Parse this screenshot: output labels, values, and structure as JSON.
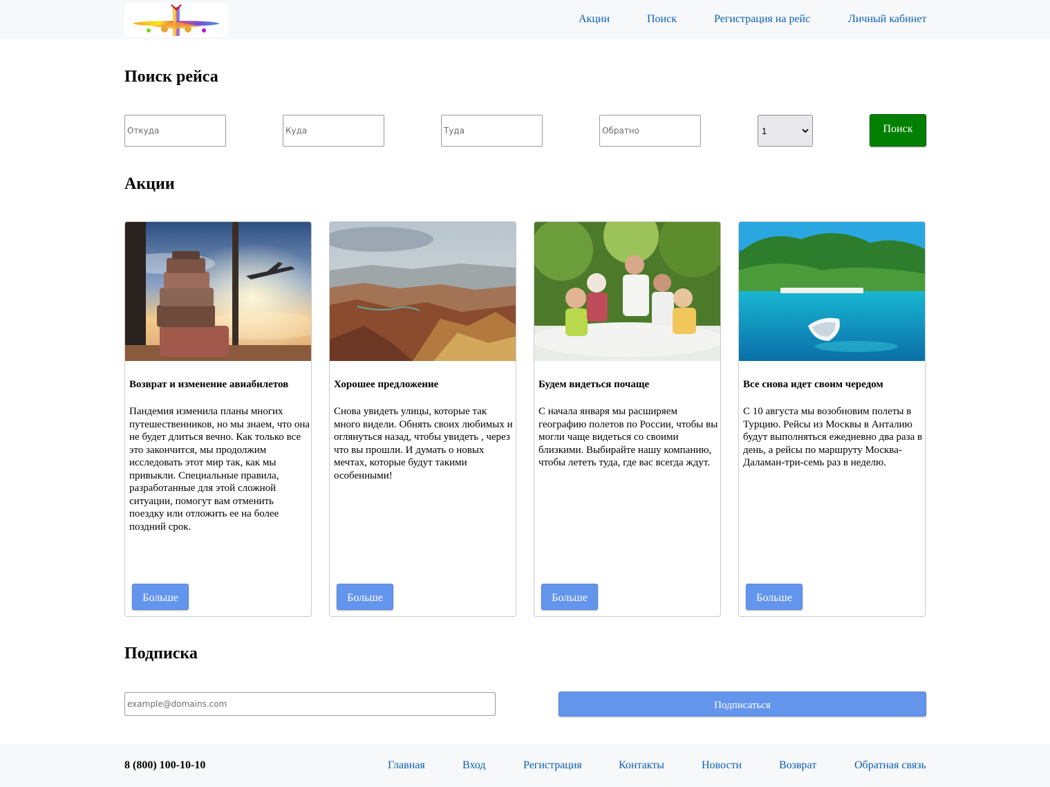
{
  "header": {
    "nav": [
      "Акции",
      "Поиск",
      "Регистрация на рейс",
      "Личный кабинет"
    ]
  },
  "search": {
    "title": "Поиск рейса",
    "from_placeholder": "Откуда",
    "to_placeholder": "Куда",
    "depart_placeholder": "Туда",
    "return_placeholder": "Обратно",
    "passengers_value": "1",
    "button_label": "Поиск",
    "button_color": "#008000"
  },
  "promos": {
    "title": "Акции",
    "more_label": "Больше",
    "accent_color": "#6495ed",
    "cards": [
      {
        "title": "Возврат и изменение авиабилетов",
        "text": "Пандемия изменила планы многих путешественников, но мы знаем, что она не будет длиться вечно. Как только все это закончится, мы продолжим исследовать этот мир так, как мы привыкли. Специальные правила, разработанные для этой сложной ситуации, помогут вам отменить поездку или отложить ее на более поздний срок.",
        "image": "suitcases-airplane-sunset"
      },
      {
        "title": "Хорошее предложение",
        "text": "Снова увидеть улицы, которые так много видели. Обнять своих любимых и оглянуться назад, чтобы увидеть , через что вы прошли. И думать о новых мечтах, которые будут такими особенными!",
        "image": "canyon-landscape"
      },
      {
        "title": "Будем видеться почаще",
        "text": "С начала января мы расширяем географию полетов по России, чтобы вы могли чаще видеться со своими близкими. Выбирайте нашу компанию, чтобы лететь туда, где вас всегда ждут.",
        "image": "family-dinner-outdoors"
      },
      {
        "title": "Все снова идет своим чередом",
        "text": "С 10 августа мы возобновим полеты в Турцию. Рейсы из Москвы в Анталию будут выполняться ежедневно два раза в день, а рейсы по маршруту Москва-Даламан-три-семь раз в неделю.",
        "image": "turquoise-bay-boat"
      }
    ]
  },
  "subscribe": {
    "title": "Подписка",
    "email_placeholder": "example@domains.com",
    "button_label": "Подписаться"
  },
  "footer": {
    "phone": "8 (800) 100-10-10",
    "links": [
      "Главная",
      "Вход",
      "Регистрация",
      "Контакты",
      "Новости",
      "Возврат",
      "Обратная связь"
    ]
  }
}
